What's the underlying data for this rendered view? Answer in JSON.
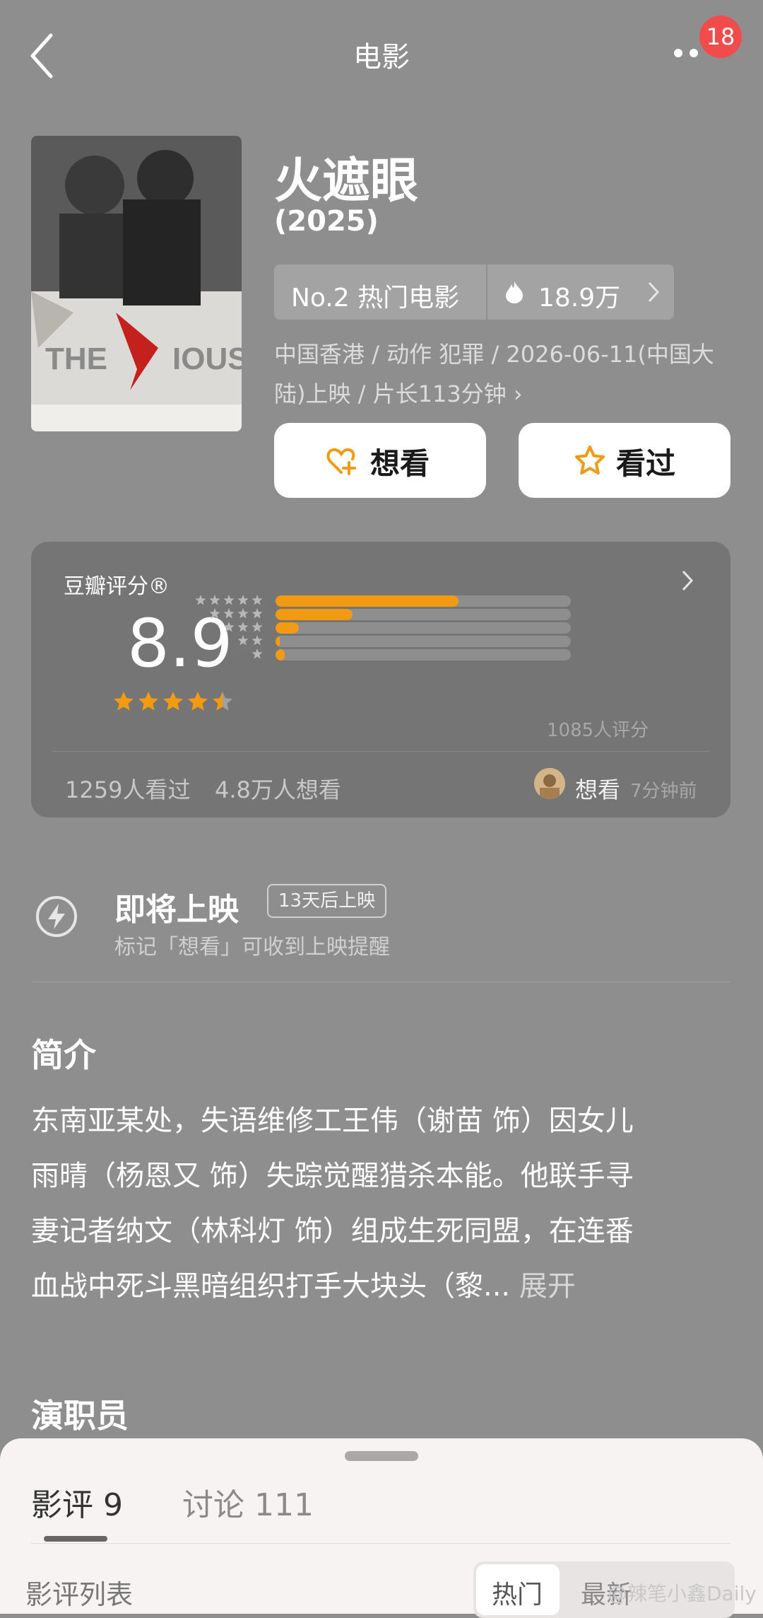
{
  "header": {
    "title": "电影",
    "notification_count": "18"
  },
  "movie": {
    "title": "火遮眼",
    "year": "(2025)",
    "rank_label": "No.2 热门电影",
    "heat": "18.9万",
    "meta_line1": "中国香港 / 动作 犯罪 / 2026-06-11(中国大",
    "meta_line2": "陆)上映 / 片长113分钟 ›",
    "want_label": "想看",
    "seen_label": "看过"
  },
  "rating": {
    "heading": "豆瓣评分®",
    "score": "8.9",
    "stars": 4.5,
    "distribution": [
      0.62,
      0.26,
      0.08,
      0.01,
      0.03
    ],
    "count_text": "1085人评分",
    "seen_text": "1259人看过",
    "want_text": "4.8万人想看",
    "recent_action": "想看",
    "recent_time": "7分钟前"
  },
  "coming_soon": {
    "title": "即将上映",
    "tag": "13天后上映",
    "hint": "标记「想看」可收到上映提醒"
  },
  "intro": {
    "title": "简介",
    "lines": [
      "东南亚某处，失语维修工王伟（谢苗 饰）因女儿",
      "雨晴（杨恩又 饰）失踪觉醒猎杀本能。他联手寻",
      "妻记者纳文（林科灯 饰）组成生死同盟，在连番",
      "血战中死斗黑暗组织打手大块头（黎..."
    ],
    "expand_label": "展开"
  },
  "cast": {
    "title": "演职员"
  },
  "sheet": {
    "tab_reviews": "影评 9",
    "tab_discussions": "讨论 111",
    "list_label": "影评列表",
    "sort_hot": "热门",
    "sort_new": "最新"
  },
  "watermark": "@辣笔小鑫Daily",
  "colors": {
    "accent": "#f29a12",
    "badge": "#f24b4b"
  }
}
